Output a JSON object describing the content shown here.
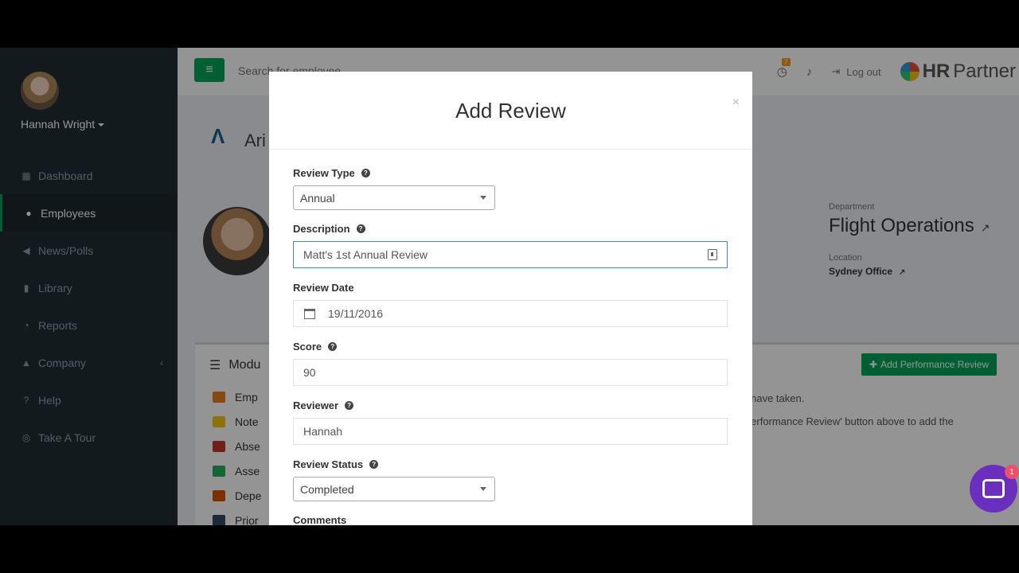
{
  "user": {
    "name": "Hannah Wright"
  },
  "sidebar": {
    "items": [
      {
        "label": "Dashboard",
        "icon": "dashboard-icon",
        "active": false
      },
      {
        "label": "Employees",
        "icon": "users-icon",
        "active": true
      },
      {
        "label": "News/Polls",
        "icon": "bullhorn-icon",
        "active": false
      },
      {
        "label": "Library",
        "icon": "book-icon",
        "active": false
      },
      {
        "label": "Reports",
        "icon": "chart-icon",
        "active": false
      },
      {
        "label": "Company",
        "icon": "building-icon",
        "active": false
      },
      {
        "label": "Help",
        "icon": "help-icon",
        "active": false
      },
      {
        "label": "Take A Tour",
        "icon": "tour-icon",
        "active": false
      }
    ]
  },
  "topbar": {
    "search_placeholder": "Search for employee...",
    "badge_count": "7",
    "logout_label": "Log out",
    "logo_a": "HR",
    "logo_b": "Partner"
  },
  "background": {
    "company_name": "Ari",
    "department_label": "Department",
    "department": "Flight Operations",
    "location_label": "Location",
    "location": "Sydney Office",
    "panel_title": "Modu",
    "add_review_button": "Add Performance Review",
    "panel_text_1": "y have taken.",
    "panel_text_2": "l Performance Review' button above to add the",
    "modules": [
      "Emp",
      "Note",
      "Abse",
      "Asse",
      "Depe",
      "Prior"
    ]
  },
  "modal": {
    "title": "Add Review",
    "close": "×",
    "review_type_label": "Review Type",
    "review_type_value": "Annual",
    "description_label": "Description",
    "description_value": "Matt's 1st Annual Review",
    "review_date_label": "Review Date",
    "review_date_value": "19/11/2016",
    "score_label": "Score",
    "score_value": "90",
    "reviewer_label": "Reviewer",
    "reviewer_value": "Hannah",
    "status_label": "Review Status",
    "status_value": "Completed",
    "comments_label": "Comments"
  },
  "chat": {
    "badge": "1"
  },
  "colors": {
    "accent": "#00a65a",
    "sidebar": "#222d32",
    "chat": "#6b2fbf"
  }
}
